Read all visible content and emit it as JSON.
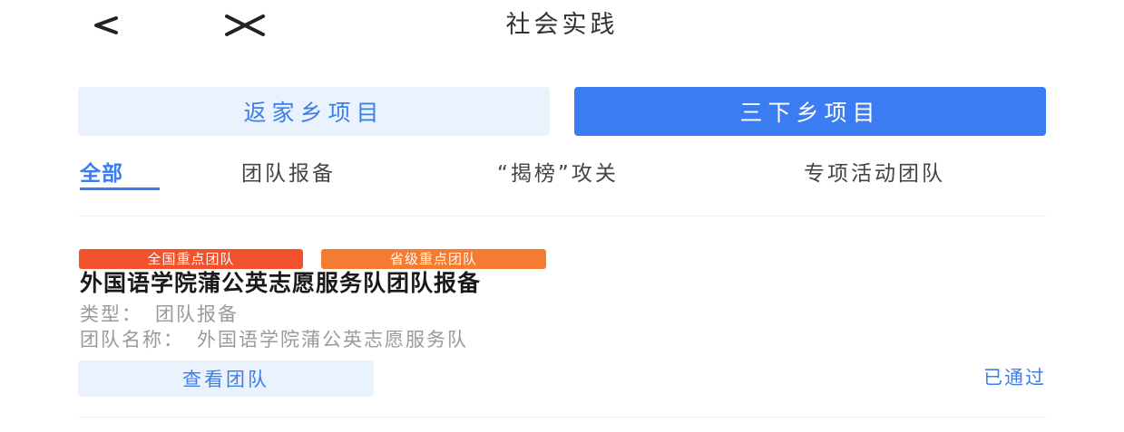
{
  "header": {
    "title": "社会实践",
    "back_icon": "chevron-left-icon",
    "close_icon": "close-icon"
  },
  "segments": {
    "home_project": "返家乡项目",
    "rural_project": "三下乡项目",
    "active": "rural_project"
  },
  "tabs": [
    {
      "label": "全部",
      "active": true
    },
    {
      "label": "团队报备",
      "active": false
    },
    {
      "label": "“揭榜”攻关",
      "active": false
    },
    {
      "label": "专项活动团队",
      "active": false
    }
  ],
  "card": {
    "badges": [
      "全国重点团队",
      "省级重点团队"
    ],
    "title": "外国语学院蒲公英志愿服务队团队报备",
    "type_label": "类型：",
    "type_value": "团队报备",
    "team_name_label": "团队名称：",
    "team_name_value": "外国语学院蒲公英志愿服务队",
    "view_button": "查看团队",
    "status": "已通过"
  },
  "colors": {
    "accent": "#3b7cf2",
    "accent_light": "#eaf2fd",
    "badge_national": "#f0522e",
    "badge_provincial": "#f37b32"
  }
}
